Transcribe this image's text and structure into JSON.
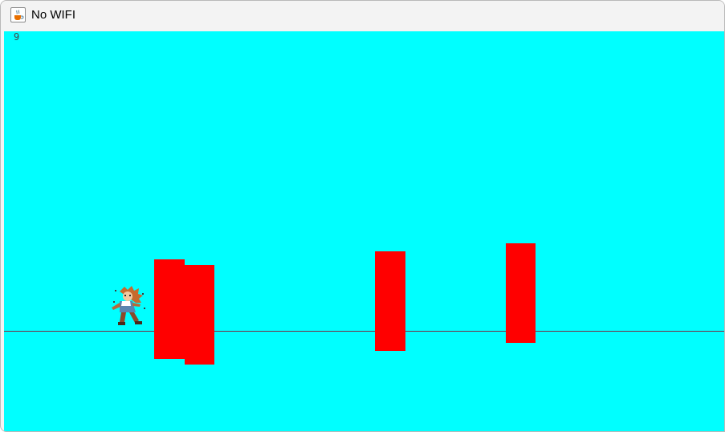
{
  "window": {
    "title": "No WIFI",
    "app_icon": "java-coffee-cup-icon"
  },
  "game": {
    "score": "9",
    "bottom_text": "",
    "colors": {
      "sky": "#00ffff",
      "obstacle": "#ff0000",
      "ground_line": "#7a2a40"
    },
    "obstacles_count": 4
  }
}
